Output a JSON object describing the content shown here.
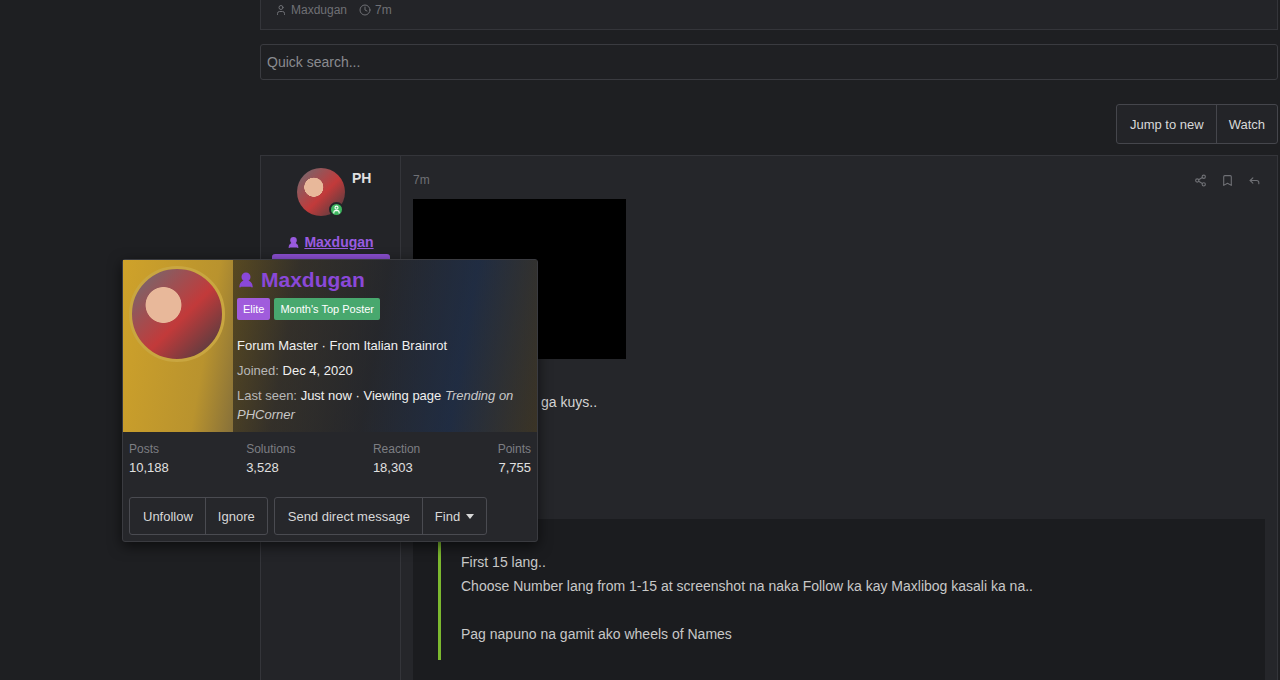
{
  "thread_meta": {
    "author": "Maxdugan",
    "time": "7m"
  },
  "search": {
    "placeholder": "Quick search..."
  },
  "thread_buttons": [
    "Jump to new",
    "Watch"
  ],
  "post": {
    "author": "Maxdugan",
    "country": "PH",
    "online": true,
    "time": "7m",
    "body": "ga kuys..",
    "quote": [
      [
        "First 15 lang..",
        "Choose Number lang from 1-15 at screenshot na naka Follow ka kay Maxlibog kasali ka na.."
      ],
      [
        "Pag napuno na gamit ako wheels of Names"
      ]
    ]
  },
  "profile_card": {
    "name": "Maxdugan",
    "badges": [
      {
        "label": "Elite",
        "color": "#a05cdc"
      },
      {
        "label": "Month's Top Poster",
        "color": "#48a86e"
      }
    ],
    "title": "Forum Master · From Italian Brainrot",
    "joined": {
      "label": "Joined:",
      "value": "Dec 4, 2020"
    },
    "last_seen": {
      "label": "Last seen:",
      "value": "Just now · Viewing page",
      "page": "Trending on PHCorner"
    },
    "stats": [
      {
        "label": "Posts",
        "value": "10,188"
      },
      {
        "label": "Solutions",
        "value": "3,528"
      },
      {
        "label": "Reaction",
        "value": "18,303"
      },
      {
        "label": "Points",
        "value": "7,755"
      }
    ],
    "button_groups": [
      [
        {
          "label": "Unfollow",
          "dropdown": false
        },
        {
          "label": "Ignore",
          "dropdown": false
        }
      ],
      [
        {
          "label": "Send direct message",
          "dropdown": false
        },
        {
          "label": "Find",
          "dropdown": true
        }
      ]
    ]
  }
}
